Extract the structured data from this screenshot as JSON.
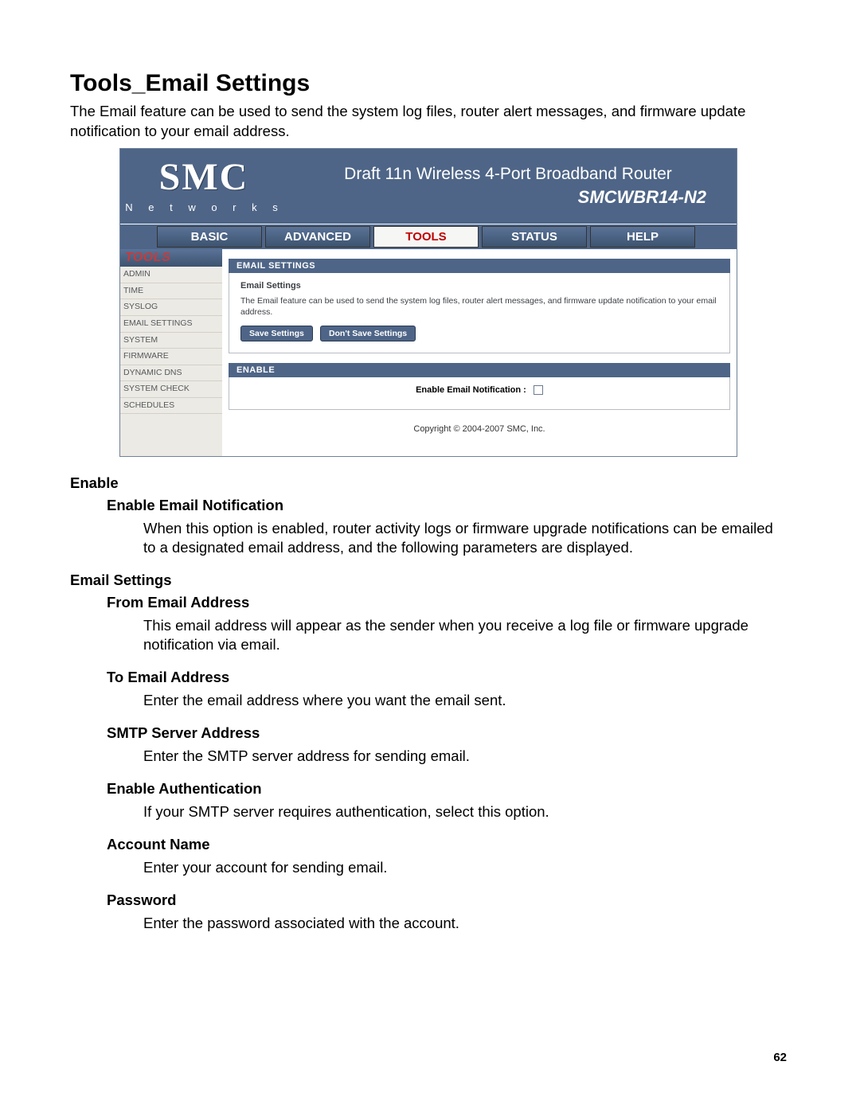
{
  "page": {
    "title": "Tools_Email Settings",
    "intro": "The Email feature can be used to send the system log files, router alert messages, and firmware update notification to your email address.",
    "number": "62"
  },
  "router": {
    "logo": {
      "brand": "SMC",
      "sub": "N e t w o r k s"
    },
    "banner": {
      "line1": "Draft 11n Wireless 4-Port Broadband Router",
      "model": "SMCWBR14-N2"
    },
    "tabs": [
      "BASIC",
      "ADVANCED",
      "TOOLS",
      "STATUS",
      "HELP"
    ],
    "active_tab": 2,
    "side": {
      "title": "TOOLS",
      "items": [
        "ADMIN",
        "TIME",
        "SYSLOG",
        "EMAIL SETTINGS",
        "SYSTEM",
        "FIRMWARE",
        "DYNAMIC DNS",
        "SYSTEM CHECK",
        "SCHEDULES"
      ]
    },
    "panel1": {
      "hdr": "EMAIL SETTINGS",
      "sub": "Email Settings",
      "desc": "The Email feature can be used to send the system log files, router alert messages, and firmware update notification to your email address.",
      "btn_save": "Save Settings",
      "btn_dont": "Don't Save Settings"
    },
    "panel2": {
      "hdr": "ENABLE",
      "label": "Enable Email Notification :"
    },
    "footer": "Copyright © 2004-2007 SMC, Inc."
  },
  "defs": [
    {
      "h1": "Enable"
    },
    {
      "h2": "Enable Email Notification",
      "p": "When this option is enabled, router activity logs or firmware upgrade notifications can be emailed to a designated email address, and the following parameters are displayed."
    },
    {
      "h1": "Email Settings"
    },
    {
      "h2": "From Email Address",
      "p": "This email address will appear as the sender when you receive a log file or firmware upgrade notification via email."
    },
    {
      "h2": "To Email Address",
      "p": "Enter the email address where you want the email sent."
    },
    {
      "h2": "SMTP Server Address",
      "p": "Enter the SMTP server address for sending email."
    },
    {
      "h2": "Enable Authentication",
      "p": "If your SMTP server requires authentication, select this option."
    },
    {
      "h2": "Account Name",
      "p": "Enter your account for sending email."
    },
    {
      "h2": "Password",
      "p": "Enter the password associated with the account."
    }
  ]
}
